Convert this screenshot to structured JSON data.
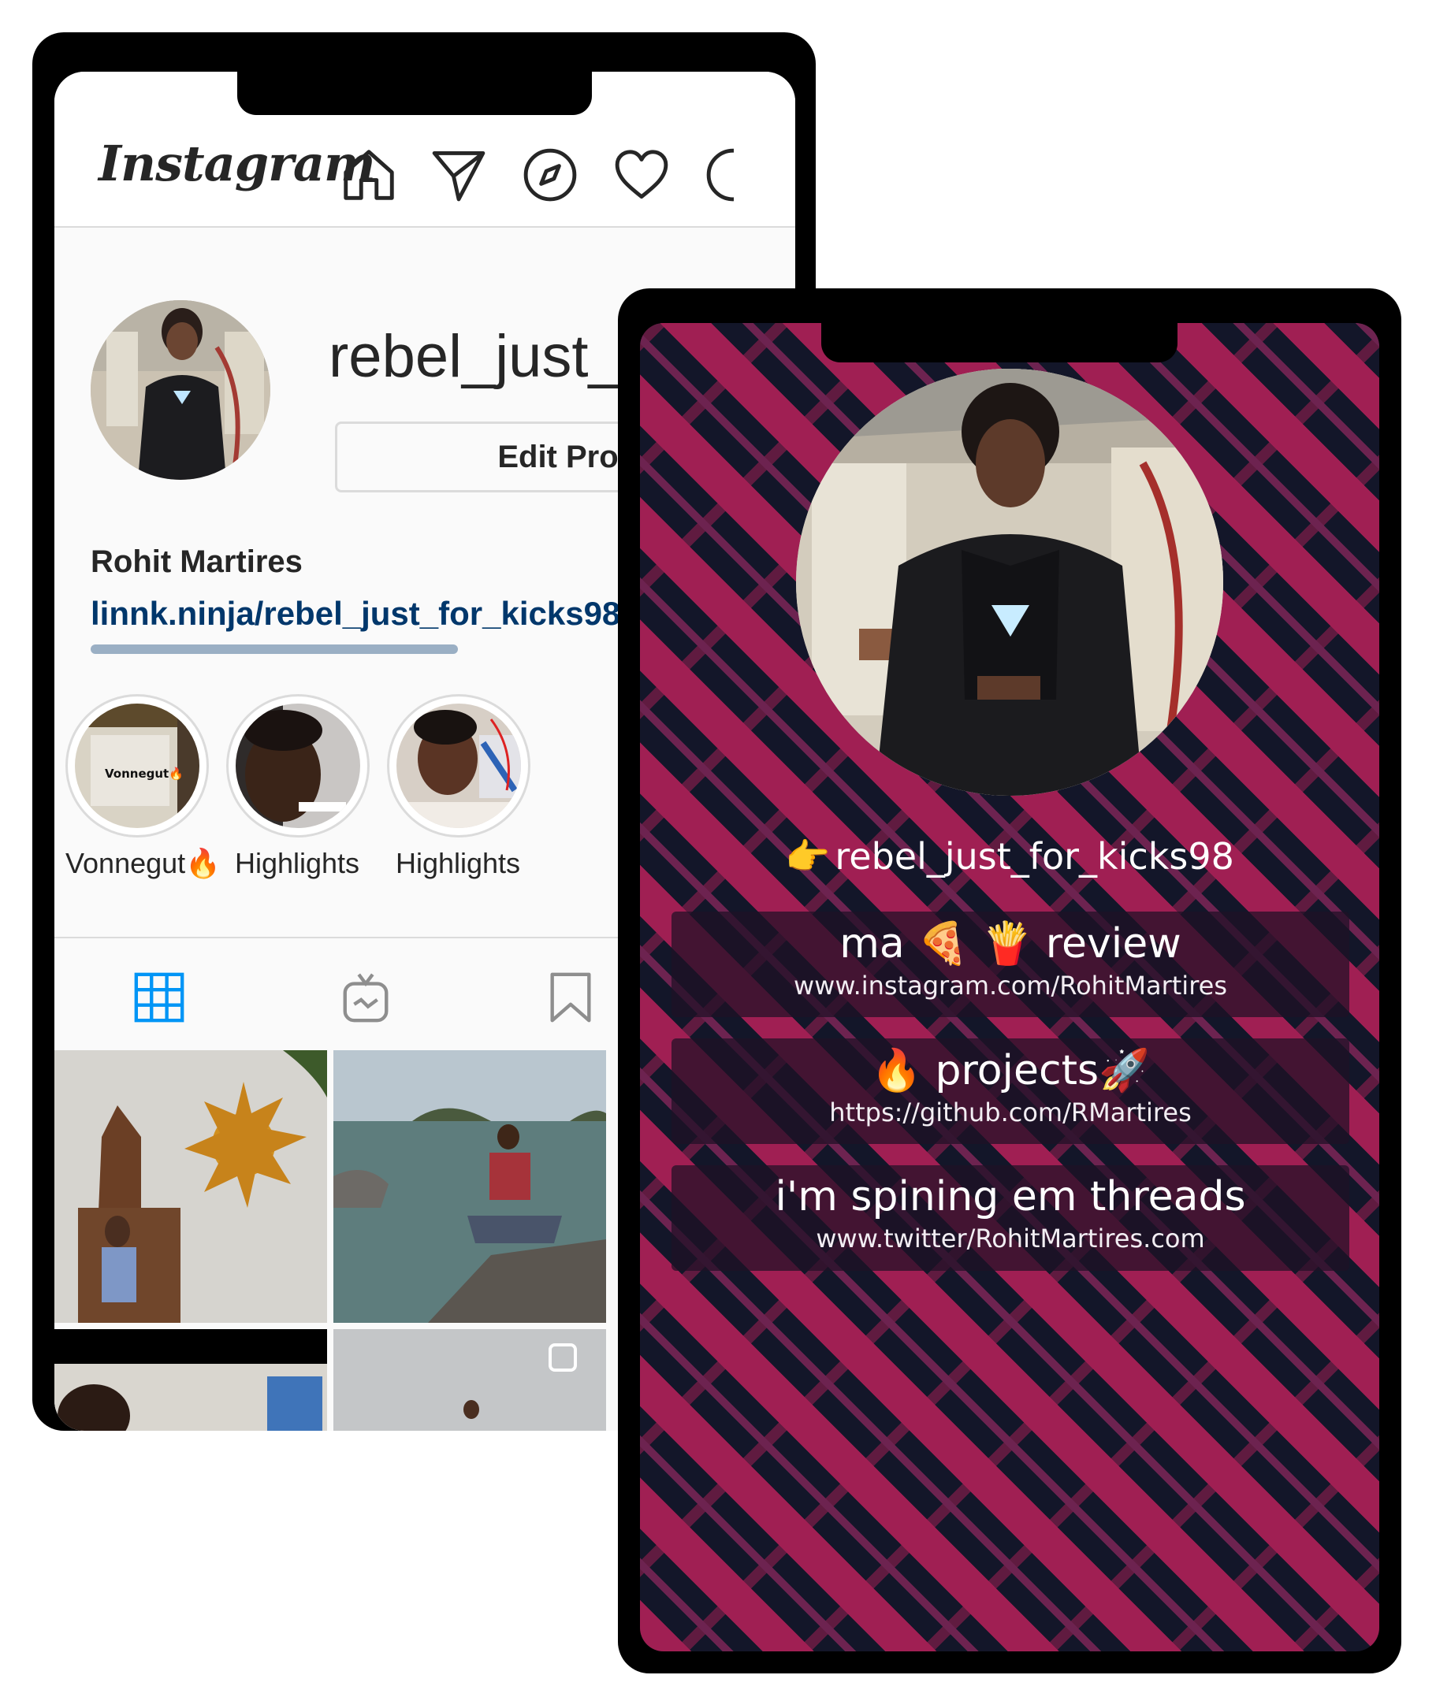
{
  "instagram": {
    "logo": "Instagram",
    "username": "rebel_just_",
    "edit_profile_label": "Edit Pro",
    "full_name": "Rohit Martires",
    "link": "linnk.ninja/rebel_just_for_kicks98",
    "nav_icons": [
      "home-icon",
      "direct-icon",
      "explore-icon",
      "heart-icon"
    ],
    "highlights": [
      {
        "label": "Vonnegut🔥",
        "thumb_text": "Vonnegut🔥"
      },
      {
        "label": "Highlights"
      },
      {
        "label": "Highlights"
      }
    ],
    "tabs": [
      "grid-icon",
      "igtv-icon",
      "saved-icon"
    ]
  },
  "linkpage": {
    "handle": "rebel_just_for_kicks98",
    "handle_emoji": "👉",
    "links": [
      {
        "title": "ma 🍕 🍟  review",
        "url": "www.instagram.com/RohitMartires"
      },
      {
        "title": "🔥 projects🚀",
        "url": "https://github.com/RMartires"
      },
      {
        "title": "i'm spining em threads",
        "url": "www.twitter/RohitMartires.com"
      }
    ]
  },
  "colors": {
    "stripe_pink": "#a01f53",
    "stripe_dark": "#131629",
    "link_blue": "#00376b",
    "ig_active_tab": "#0095f6"
  }
}
